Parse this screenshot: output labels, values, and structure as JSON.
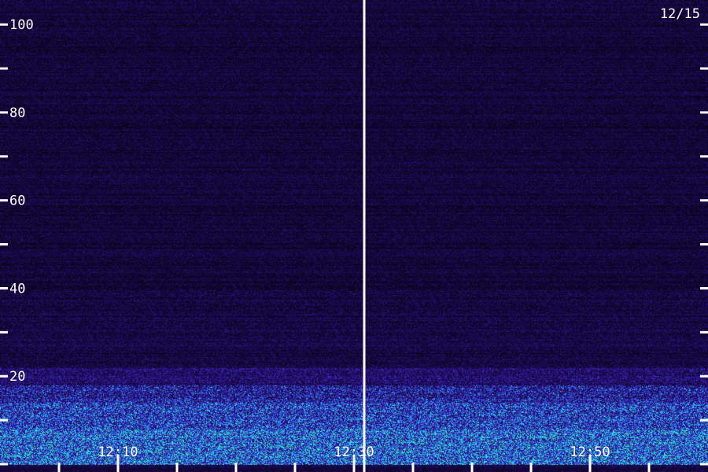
{
  "chart_data": {
    "type": "heatmap",
    "title": "",
    "xlabel": "",
    "ylabel": "",
    "date_label": "12/15",
    "x_axis": {
      "range": [
        "12:00",
        "13:00"
      ],
      "tick_labels": [
        "12:10",
        "12:30",
        "12:50"
      ],
      "major_tick_times": [
        "12:10",
        "12:30",
        "12:50"
      ],
      "minor_tick_interval_minutes": 5
    },
    "y_axis": {
      "range": [
        0,
        102
      ],
      "tick_labels": [
        "20",
        "40",
        "60",
        "80",
        "100"
      ],
      "tick_values": [
        0,
        10,
        20,
        30,
        40,
        50,
        60,
        70,
        80,
        90,
        100
      ]
    },
    "marker_time": "12:31",
    "grid": false,
    "colormap": [
      "#000000",
      "#1a0a50",
      "#3a18a8",
      "#2e6cff",
      "#28d6ff",
      "#2bff9a"
    ],
    "intensity_profile_by_band": [
      {
        "y_range": [
          0,
          8
        ],
        "level": 0.85
      },
      {
        "y_range": [
          8,
          14
        ],
        "level": 0.7
      },
      {
        "y_range": [
          14,
          18
        ],
        "level": 0.55
      },
      {
        "y_range": [
          18,
          22
        ],
        "level": 0.4
      },
      {
        "y_range": [
          22,
          40
        ],
        "level": 0.26
      },
      {
        "y_range": [
          40,
          102
        ],
        "level": 0.22
      }
    ]
  }
}
